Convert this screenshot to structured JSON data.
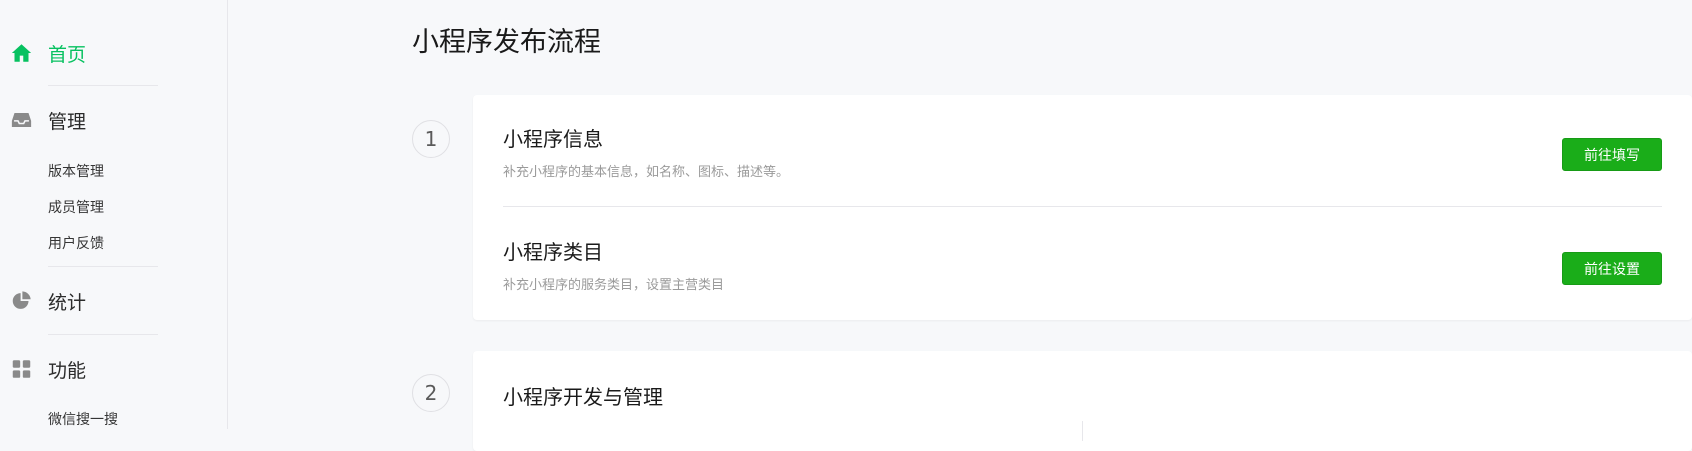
{
  "sidebar": {
    "home": {
      "label": "首页",
      "icon": "home-icon"
    },
    "manage": {
      "label": "管理",
      "icon": "inbox-icon",
      "items": [
        {
          "label": "版本管理"
        },
        {
          "label": "成员管理"
        },
        {
          "label": "用户反馈"
        }
      ]
    },
    "stats": {
      "label": "统计",
      "icon": "pie-chart-icon"
    },
    "features": {
      "label": "功能",
      "icon": "grid-icon",
      "items": [
        {
          "label": "微信搜一搜"
        }
      ]
    }
  },
  "page": {
    "title": "小程序发布流程"
  },
  "steps": [
    {
      "number": "1",
      "rows": [
        {
          "title": "小程序信息",
          "desc": "补充小程序的基本信息，如名称、图标、描述等。",
          "button": "前往填写"
        },
        {
          "title": "小程序类目",
          "desc": "补充小程序的服务类目，设置主营类目",
          "button": "前往设置"
        }
      ]
    },
    {
      "number": "2",
      "rows": [
        {
          "title": "小程序开发与管理"
        }
      ]
    }
  ],
  "colors": {
    "accent": "#07c160",
    "button": "#1aad19",
    "background": "#f7f8fa"
  }
}
